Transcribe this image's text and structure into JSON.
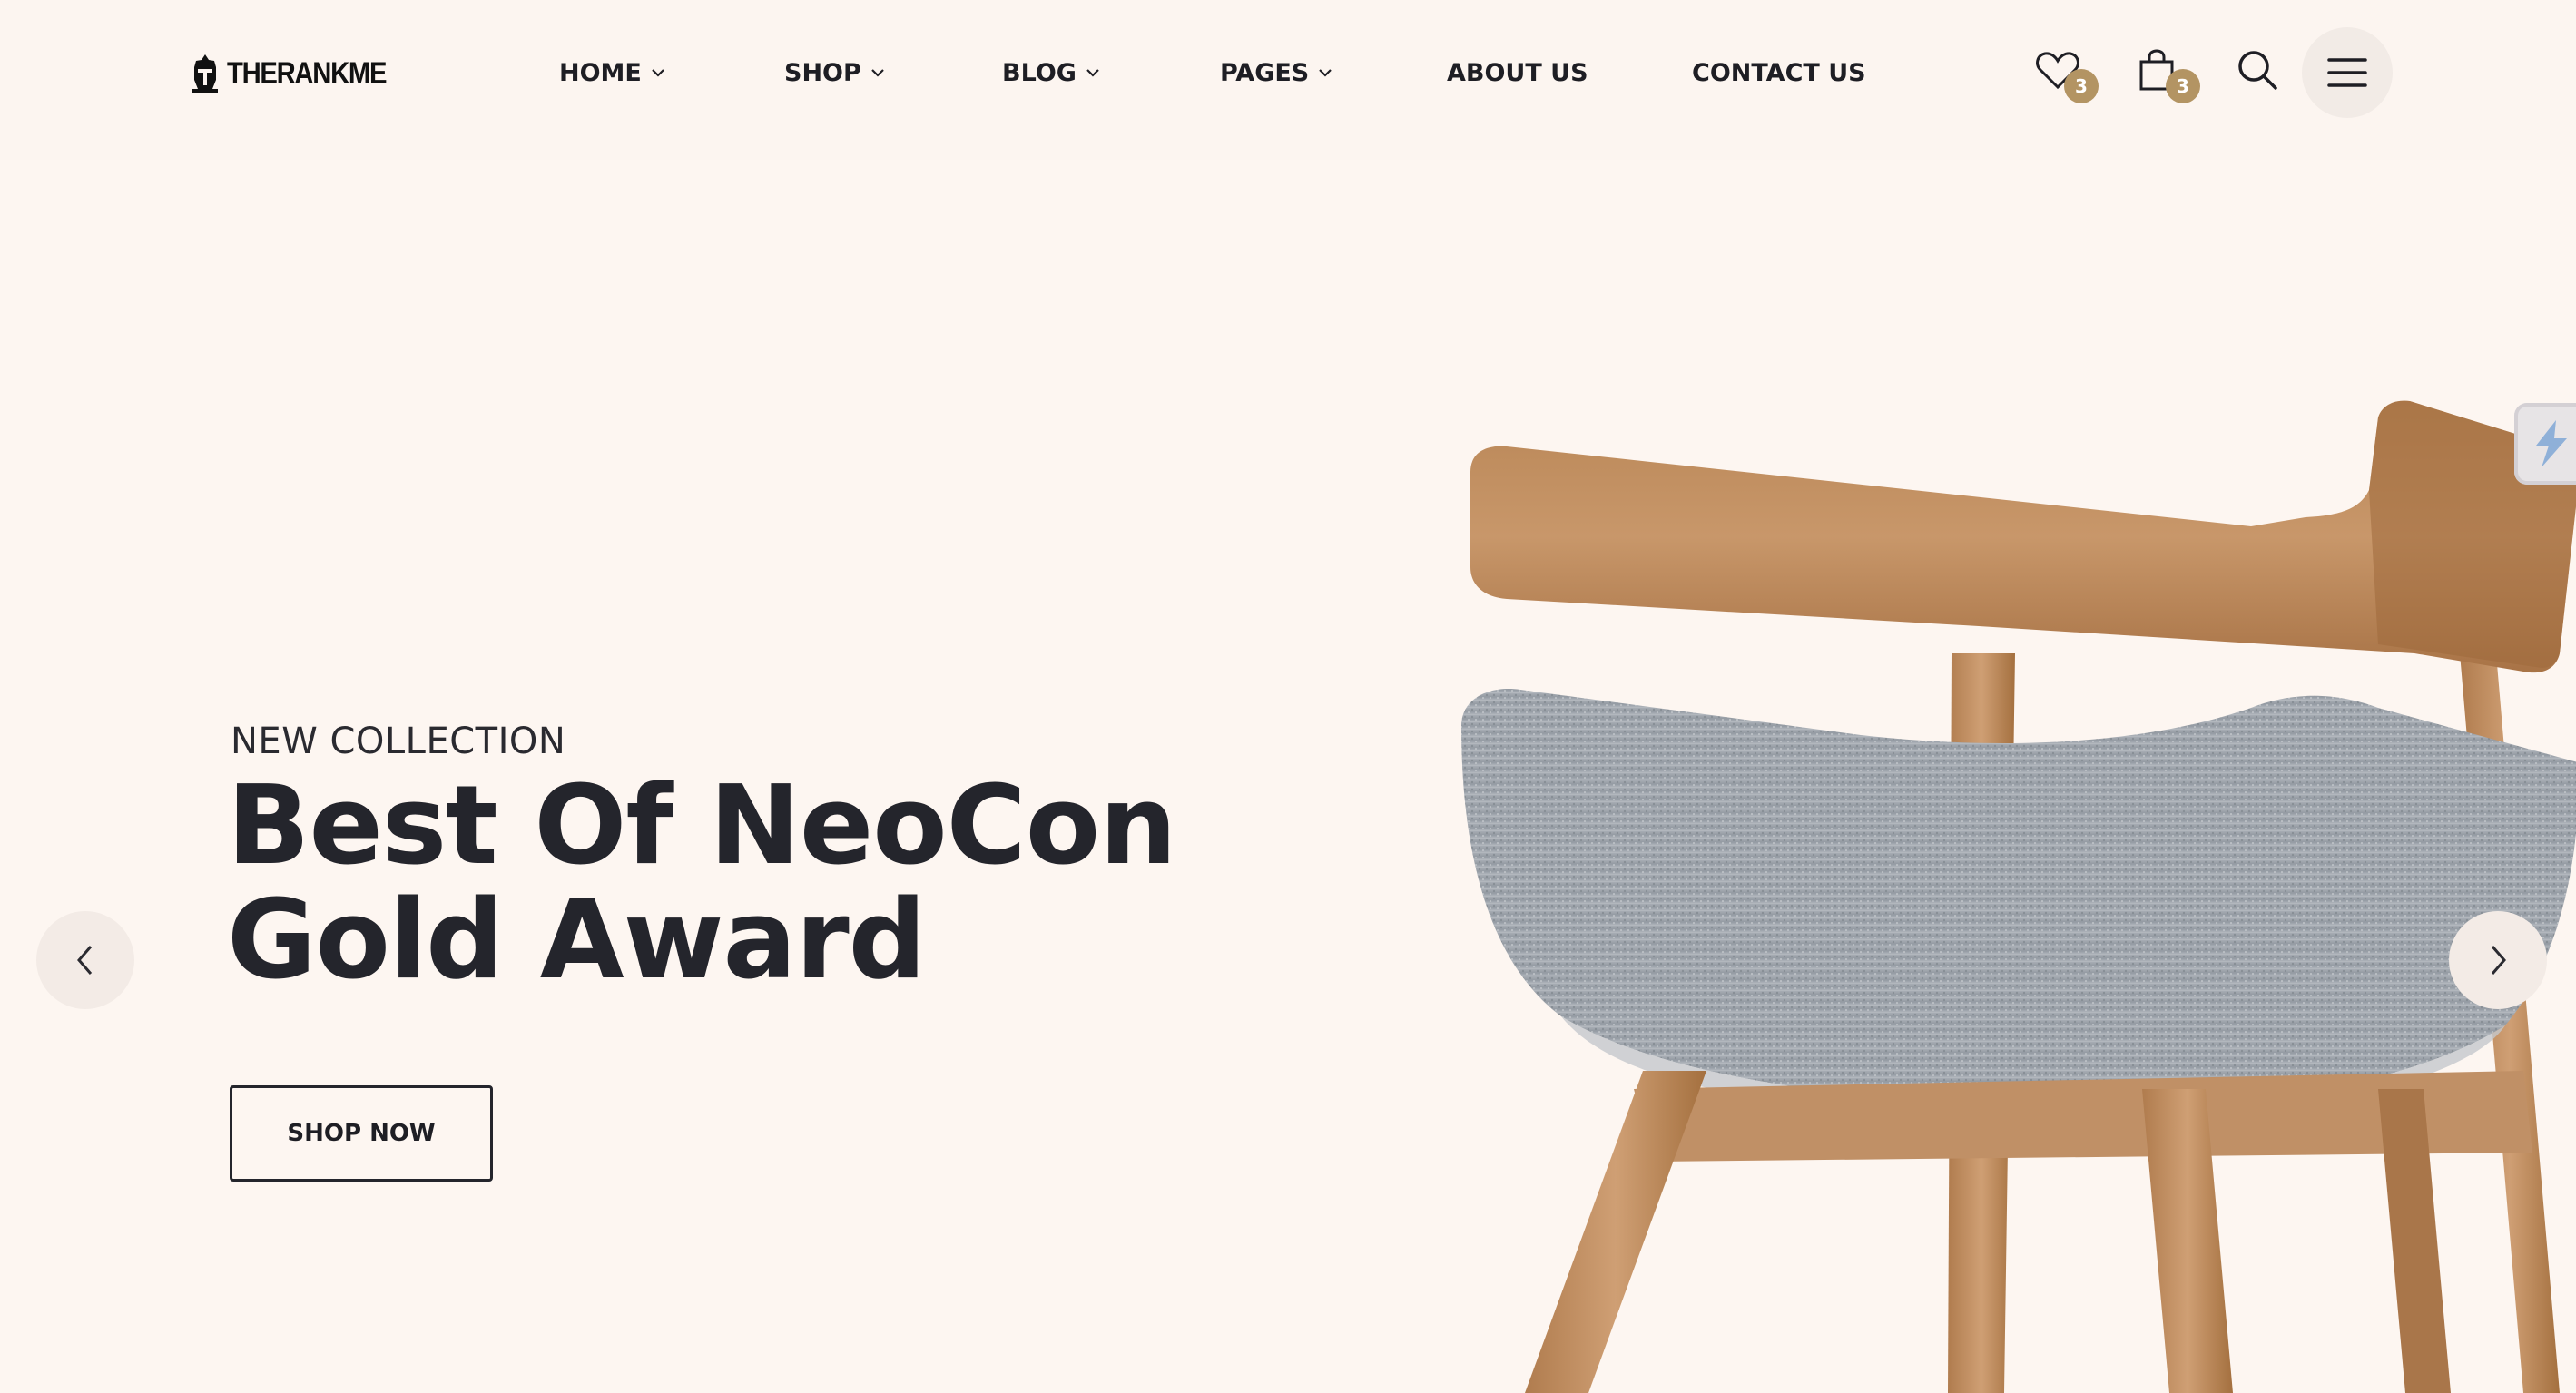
{
  "brand": {
    "logo_text": "THERANKME"
  },
  "nav": {
    "items": [
      {
        "label": "HOME",
        "has_dropdown": true
      },
      {
        "label": "SHOP",
        "has_dropdown": true
      },
      {
        "label": "BLOG",
        "has_dropdown": true
      },
      {
        "label": "PAGES",
        "has_dropdown": true
      },
      {
        "label": "ABOUT US",
        "has_dropdown": false
      },
      {
        "label": "CONTACT US",
        "has_dropdown": false
      }
    ]
  },
  "header_icons": {
    "wishlist": {
      "icon": "heart-icon",
      "count": "3"
    },
    "cart": {
      "icon": "shopping-bag-icon",
      "count": "3"
    },
    "search": {
      "icon": "search-icon"
    },
    "menu": {
      "icon": "hamburger-menu-icon"
    }
  },
  "hero": {
    "subtitle": "NEW COLLECTION",
    "title_line1": "Best Of NeoCon",
    "title_line2": "Gold Award",
    "cta_label": "SHOP NOW",
    "image": "wooden-chair-with-grey-upholstered-seat"
  },
  "slider": {
    "prev_icon": "chevron-left-icon",
    "next_icon": "chevron-right-icon"
  },
  "colors": {
    "background": "#fdf6f1",
    "header_background": "#fcf5f0",
    "badge": "#b39463",
    "text_dark": "#24252c"
  }
}
